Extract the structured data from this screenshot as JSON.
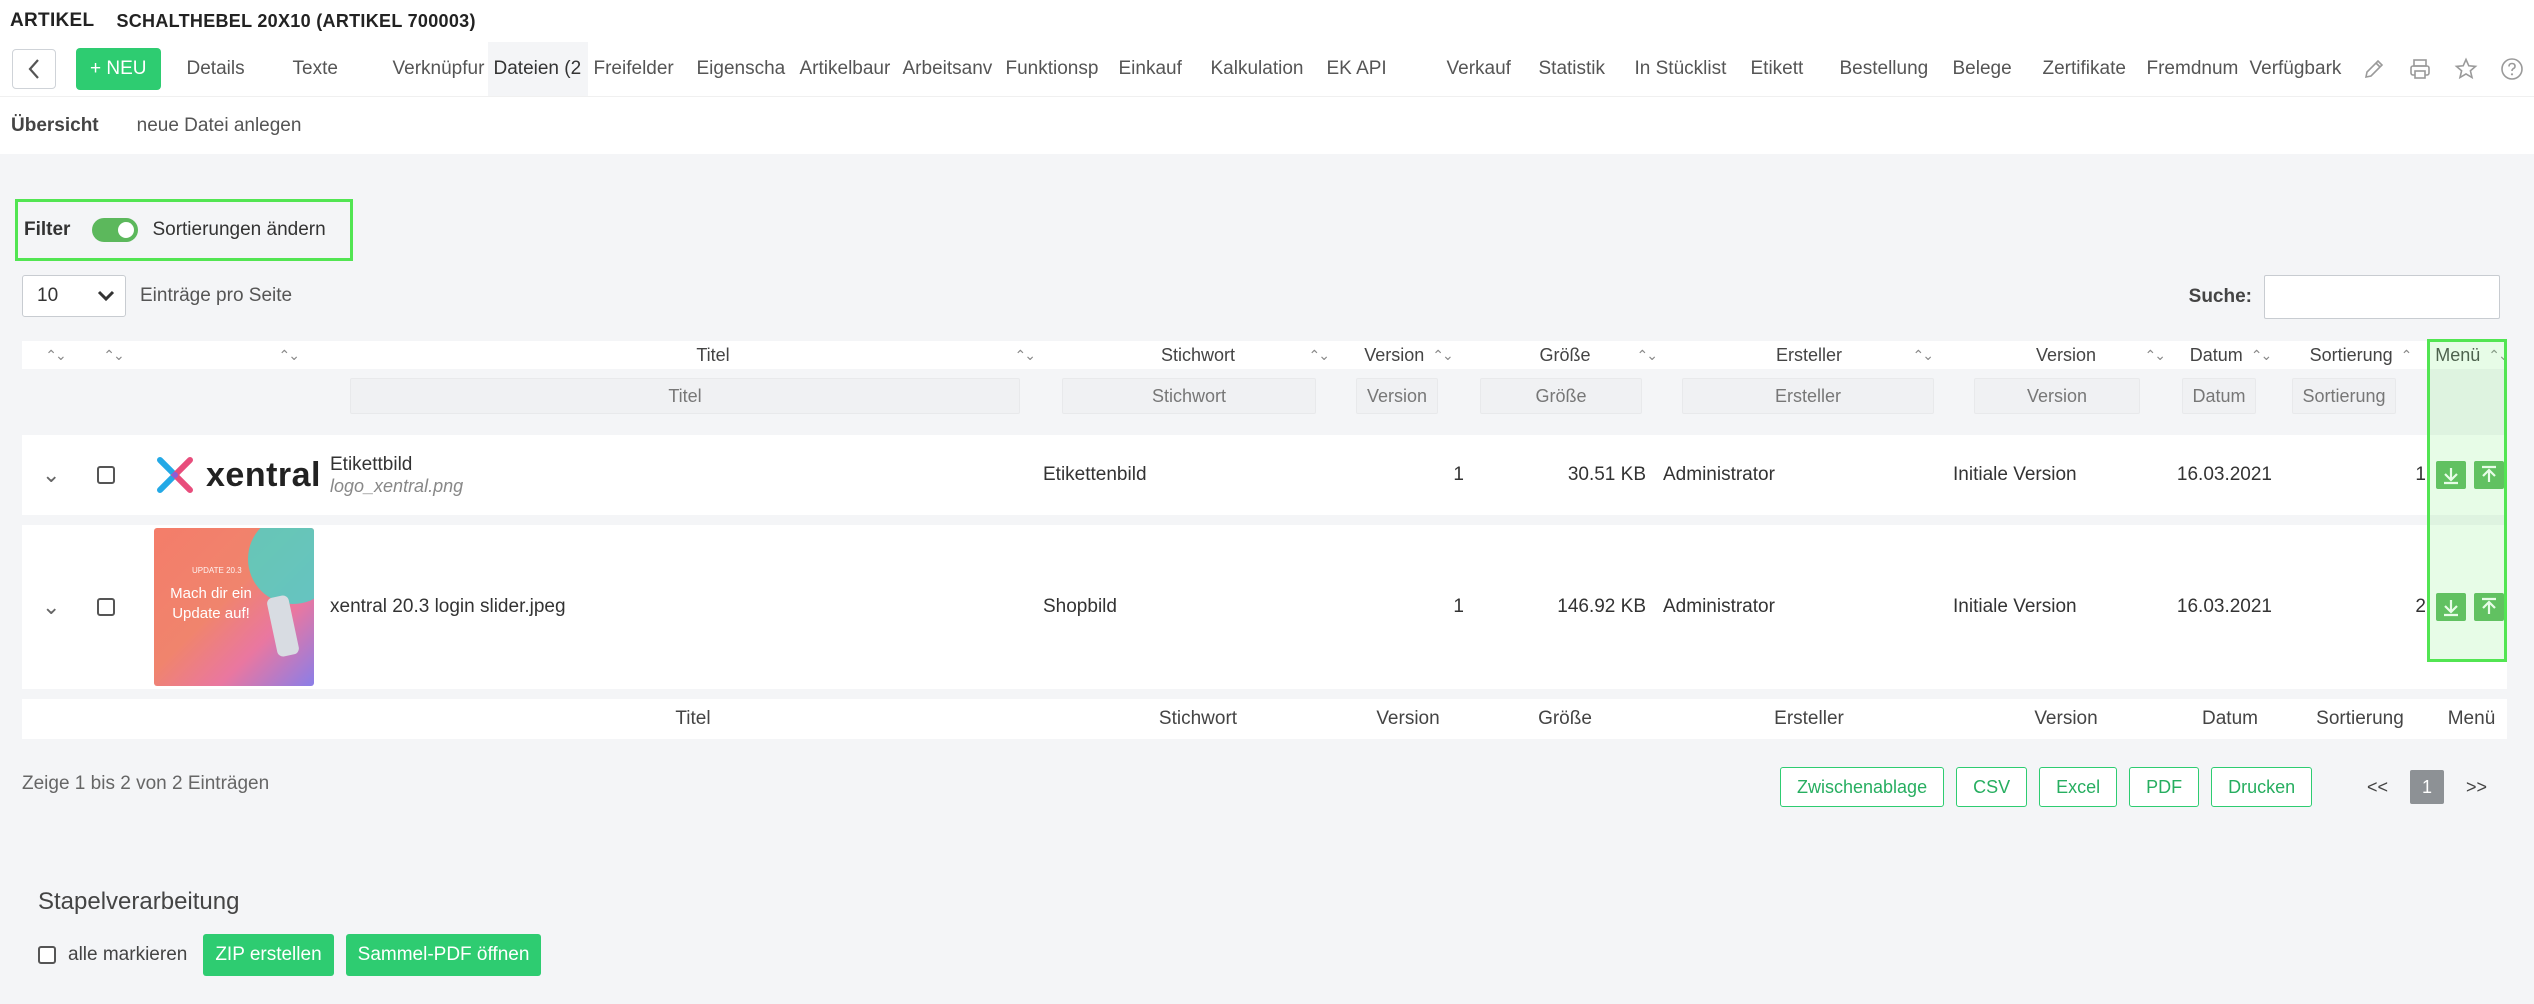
{
  "header": {
    "module": "ARTIKEL",
    "title": "SCHALTHEBEL 20X10 (ARTIKEL 700003)"
  },
  "toolbar": {
    "new_label": "+ NEU"
  },
  "tabs": [
    {
      "label": "Details"
    },
    {
      "label": "Texte"
    },
    {
      "label": "Verknüpfur"
    },
    {
      "label": "Dateien (2"
    },
    {
      "label": "Freifelder"
    },
    {
      "label": "Eigenscha"
    },
    {
      "label": "Artikelbaur"
    },
    {
      "label": "Arbeitsanv"
    },
    {
      "label": "Funktionsp"
    },
    {
      "label": "Einkauf"
    },
    {
      "label": "Kalkulation"
    },
    {
      "label": "EK API"
    },
    {
      "label": "Verkauf"
    },
    {
      "label": "Statistik"
    },
    {
      "label": "In Stücklist"
    },
    {
      "label": "Etikett"
    },
    {
      "label": "Bestellung"
    },
    {
      "label": "Belege"
    },
    {
      "label": "Zertifikate"
    },
    {
      "label": "Fremdnum"
    },
    {
      "label": "Verfügbark"
    }
  ],
  "subnav": {
    "overview": "Übersicht",
    "new_file": "neue Datei anlegen"
  },
  "filter": {
    "label": "Filter",
    "sort_label": "Sortierungen ändern",
    "enabled": true
  },
  "paging": {
    "per_page_value": "10",
    "per_page_label": "Einträge pro Seite",
    "search_label": "Suche:"
  },
  "table": {
    "columns": [
      "Titel",
      "Stichwort",
      "Version",
      "Größe",
      "Ersteller",
      "Version",
      "Datum",
      "Sortierung",
      "Menü"
    ],
    "filter_placeholders": [
      "Titel",
      "Stichwort",
      "Version",
      "Größe",
      "Ersteller",
      "Version",
      "Datum",
      "Sortierung"
    ],
    "rows": [
      {
        "thumb_text": "xentral",
        "title": "Etikettbild",
        "filename": "logo_xentral.png",
        "keyword": "Etikettenbild",
        "version": "1",
        "size": "30.51 KB",
        "creator": "Administrator",
        "version_name": "Initiale Version",
        "date": "16.03.2021",
        "sort": "1"
      },
      {
        "thumb_caption": "UPDATE 20.3",
        "thumb_text": "Mach dir ein Update auf!",
        "title": "xentral 20.3 login slider.jpeg",
        "keyword": "Shopbild",
        "version": "1",
        "size": "146.92 KB",
        "creator": "Administrator",
        "version_name": "Initiale Version",
        "date": "16.03.2021",
        "sort": "2"
      }
    ]
  },
  "info": "Zeige 1 bis 2 von 2 Einträgen",
  "exports": [
    "Zwischenablage",
    "CSV",
    "Excel",
    "PDF",
    "Drucken"
  ],
  "pager": {
    "prev": "<<",
    "current": "1",
    "next": ">>"
  },
  "batch": {
    "heading": "Stapelverarbeitung",
    "mark_all": "alle markieren",
    "zip": "ZIP erstellen",
    "pdf": "Sammel-PDF öffnen"
  },
  "colors": {
    "accent": "#2ecc71",
    "highlight": "#52e552",
    "action": "#5cb85c"
  }
}
